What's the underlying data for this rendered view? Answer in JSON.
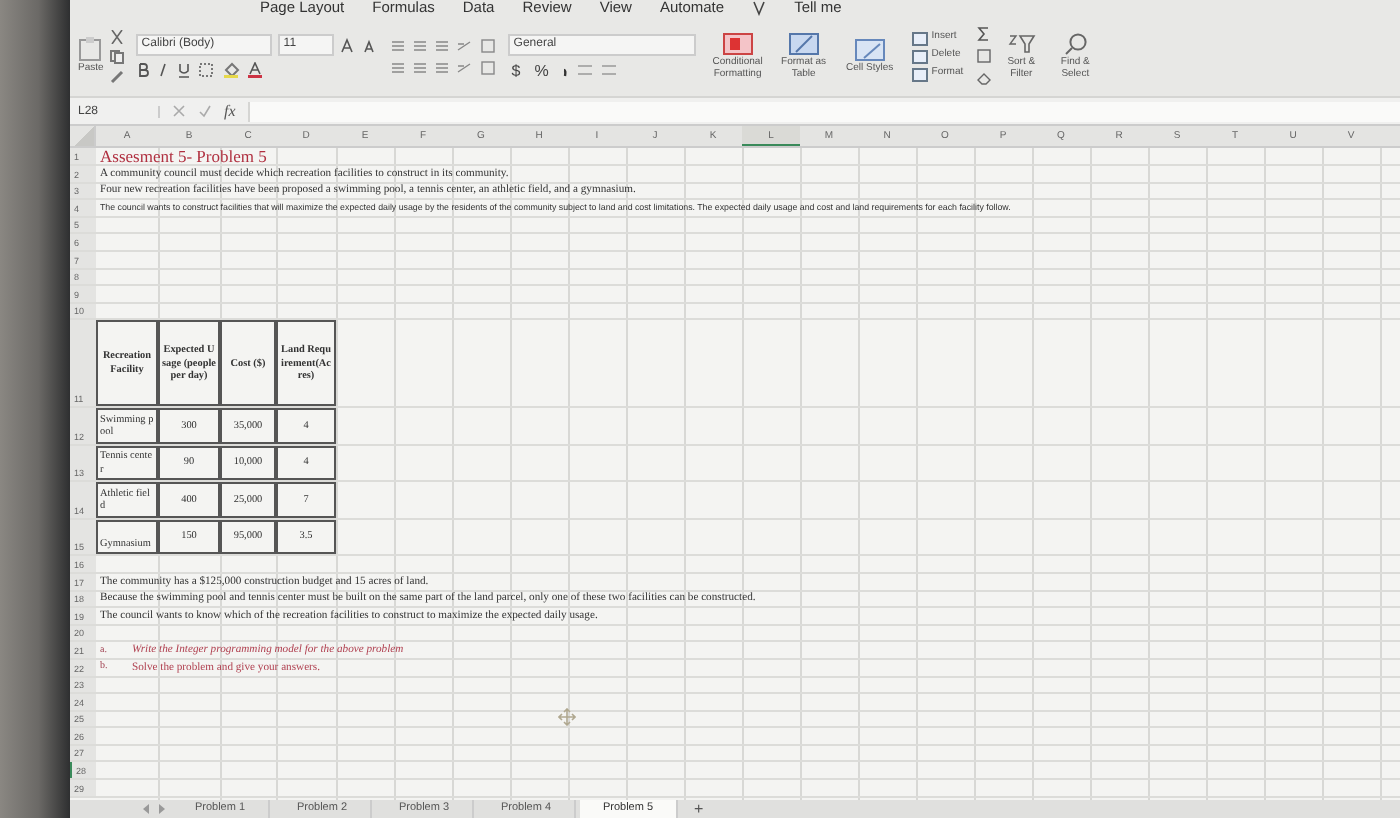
{
  "menu_tabs": [
    {
      "label": "Page Layout",
      "selected": false
    },
    {
      "label": "Formulas",
      "selected": false
    },
    {
      "label": "Data",
      "selected": false
    },
    {
      "label": "Review",
      "selected": false
    },
    {
      "label": "View",
      "selected": false
    },
    {
      "label": "Automate",
      "selected": false
    }
  ],
  "tell_me": "Tell me",
  "ribbon": {
    "paste": "Paste",
    "font": "Calibri (Body)",
    "size": "11",
    "number_format": "General",
    "number_buttons": [
      "$",
      "%"
    ],
    "style_buttons": [
      "Conditional Formatting",
      "Format as Table",
      "Cell Styles"
    ],
    "cell_buttons": [
      "Insert",
      "Delete",
      "Format"
    ],
    "edit_buttons": [
      "Sort & Filter",
      "Find & Select"
    ]
  },
  "formula_bar": {
    "name_box": "L28",
    "fx": "fx"
  },
  "columns": [
    {
      "label": "A",
      "selected": false
    },
    {
      "label": "B",
      "selected": false
    },
    {
      "label": "C",
      "selected": false
    },
    {
      "label": "D",
      "selected": false
    },
    {
      "label": "E",
      "selected": false
    },
    {
      "label": "F",
      "selected": false
    },
    {
      "label": "G",
      "selected": false
    },
    {
      "label": "H",
      "selected": false
    },
    {
      "label": "I",
      "selected": false
    },
    {
      "label": "J",
      "selected": false
    },
    {
      "label": "K",
      "selected": false
    },
    {
      "label": "L",
      "selected": true
    },
    {
      "label": "M",
      "selected": false
    },
    {
      "label": "N",
      "selected": false
    },
    {
      "label": "O",
      "selected": false
    },
    {
      "label": "P",
      "selected": false
    },
    {
      "label": "Q",
      "selected": false
    },
    {
      "label": "R",
      "selected": false
    },
    {
      "label": "S",
      "selected": false
    },
    {
      "label": "T",
      "selected": false
    },
    {
      "label": "U",
      "selected": false
    },
    {
      "label": "V",
      "selected": false
    }
  ],
  "rows": [
    {
      "number": "1",
      "kind": "title",
      "text": "Assesment 5- Problem 5",
      "selected": false
    },
    {
      "number": "2",
      "kind": "text",
      "text": "A community council must decide which recreation facilities to construct in its community.",
      "selected": false
    },
    {
      "number": "3",
      "kind": "text",
      "text": "Four new recreation facilities have been proposed a swimming pool, a tennis center, an athletic field, and a gymnasium.",
      "selected": false
    },
    {
      "number": "4",
      "kind": "small",
      "text": "The council wants to construct facilities that will maximize the expected daily usage by the residents of the community subject to land and cost limitations.  The expected daily usage and cost and land requirements for each facility follow.",
      "selected": false
    },
    {
      "number": "5",
      "kind": "blank",
      "selected": false
    },
    {
      "number": "6",
      "kind": "blank",
      "selected": false
    },
    {
      "number": "7",
      "kind": "blank",
      "selected": false
    },
    {
      "number": "8",
      "kind": "blank",
      "selected": false
    },
    {
      "number": "9",
      "kind": "blank",
      "selected": false
    },
    {
      "number": "10",
      "kind": "blank",
      "selected": false
    },
    {
      "number": "11",
      "kind": "table_header",
      "cells": [
        "Recreation Facility",
        "Expected Usage (people per day)",
        "Cost ($)",
        "Land Requirement(Acres)"
      ],
      "selected": false
    },
    {
      "number": "12",
      "kind": "table_row",
      "cells": [
        "Swimming pool",
        "300",
        "35,000",
        "4"
      ],
      "selected": false
    },
    {
      "number": "13",
      "kind": "table_row",
      "cells": [
        "Tennis center",
        "90",
        "10,000",
        "4"
      ],
      "selected": false
    },
    {
      "number": "14",
      "kind": "table_row",
      "cells": [
        "Athletic field",
        "400",
        "25,000",
        "7"
      ],
      "selected": false
    },
    {
      "number": "15",
      "kind": "table_row",
      "cells": [
        "Gymnasium",
        "150",
        "95,000",
        "3.5"
      ],
      "selected": false
    },
    {
      "number": "16",
      "kind": "blank",
      "selected": false
    },
    {
      "number": "17",
      "kind": "text",
      "text": "The community has a $125,000 construction budget and 15 acres of land.",
      "selected": false
    },
    {
      "number": "18",
      "kind": "text",
      "text": "Because the swimming pool and tennis center must be built on the same part of the land parcel, only one of these two facilities can be constructed.",
      "selected": false
    },
    {
      "number": "19",
      "kind": "text",
      "text": "The council wants to know which of the recreation facilities to construct to maximize the expected daily usage.",
      "selected": false
    },
    {
      "number": "20",
      "kind": "blank",
      "selected": false
    },
    {
      "number": "21",
      "kind": "task",
      "marker": "a.",
      "text": "Write the Integer programming model for the above problem",
      "italic": true,
      "selected": false
    },
    {
      "number": "22",
      "kind": "task",
      "marker": "b.",
      "text": "Solve the problem and give your answers.",
      "italic": false,
      "selected": false
    },
    {
      "number": "23",
      "kind": "blank",
      "selected": false
    },
    {
      "number": "24",
      "kind": "blank",
      "selected": false
    },
    {
      "number": "25",
      "kind": "blank",
      "selected": false
    },
    {
      "number": "26",
      "kind": "blank",
      "selected": false
    },
    {
      "number": "27",
      "kind": "blank",
      "selected": false
    },
    {
      "number": "28",
      "kind": "blank",
      "selected": true
    },
    {
      "number": "29",
      "kind": "blank",
      "selected": false
    }
  ],
  "sheet_tabs": [
    {
      "label": "Problem 1",
      "selected": false
    },
    {
      "label": "Problem 2",
      "selected": false
    },
    {
      "label": "Problem 3",
      "selected": false
    },
    {
      "label": "Problem 4",
      "selected": false
    },
    {
      "label": "Problem 5",
      "selected": true
    }
  ],
  "add_sheet": "+"
}
